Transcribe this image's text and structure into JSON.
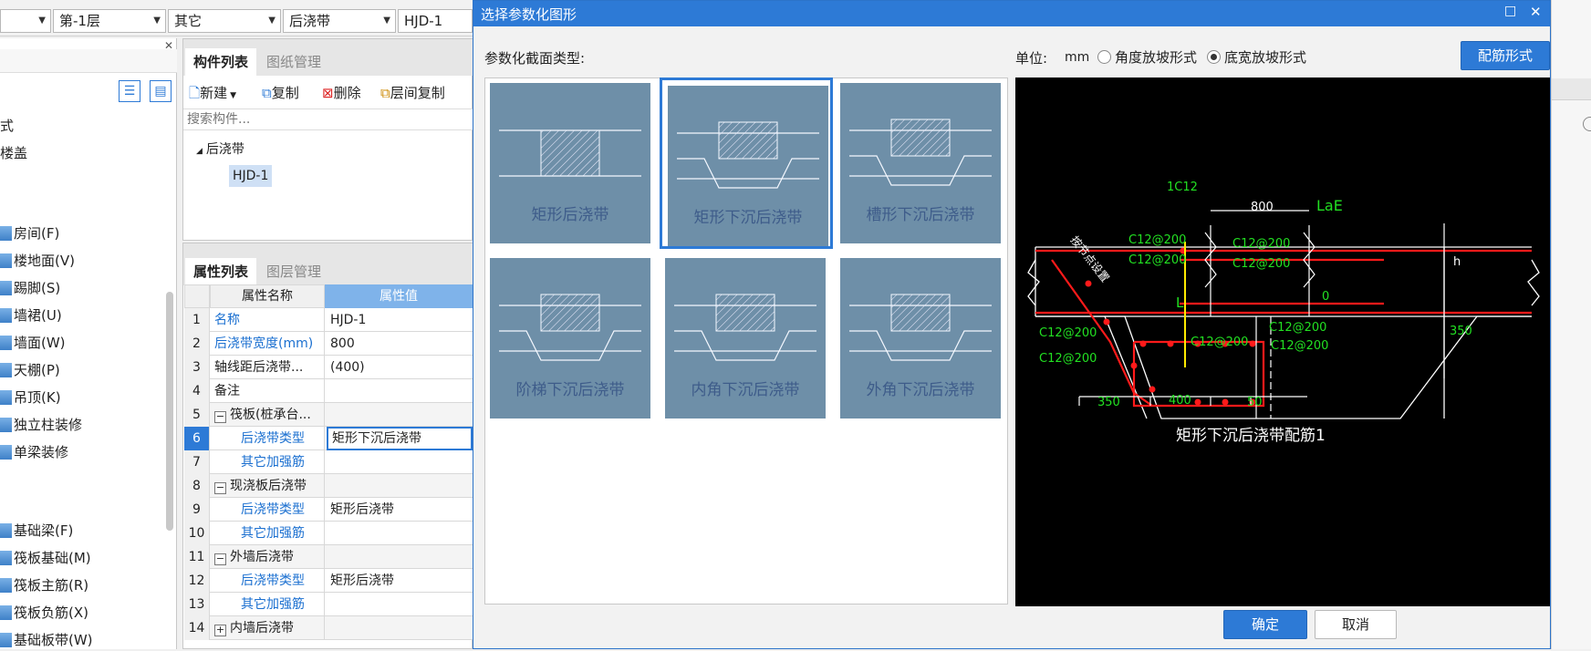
{
  "toolbar_combos": [
    {
      "value": ""
    },
    {
      "value": "第-1层"
    },
    {
      "value": "其它"
    },
    {
      "value": "后浇带"
    },
    {
      "value": "HJD-1"
    }
  ],
  "left_nav": {
    "partial_items": [
      {
        "label": "式"
      },
      {
        "label": "楼盖"
      }
    ],
    "items_a": [
      {
        "label": "房间(F)",
        "icon": "room-icon"
      },
      {
        "label": "楼地面(V)",
        "icon": "floor-icon"
      },
      {
        "label": "踢脚(S)",
        "icon": "skirting-icon"
      },
      {
        "label": "墙裙(U)",
        "icon": "wainscot-icon"
      },
      {
        "label": "墙面(W)",
        "icon": "wall-surface-icon"
      },
      {
        "label": "天棚(P)",
        "icon": "ceiling-icon"
      },
      {
        "label": "吊顶(K)",
        "icon": "suspended-ceiling-icon"
      },
      {
        "label": "独立柱装修",
        "icon": "column-finish-icon"
      },
      {
        "label": "单梁装修",
        "icon": "beam-finish-icon"
      }
    ],
    "items_b": [
      {
        "label": "基础梁(F)",
        "icon": "foundation-beam-icon"
      },
      {
        "label": "筏板基础(M)",
        "icon": "raft-foundation-icon"
      },
      {
        "label": "筏板主筋(R)",
        "icon": "raft-main-rebar-icon"
      },
      {
        "label": "筏板负筋(X)",
        "icon": "raft-neg-rebar-icon"
      },
      {
        "label": "基础板带(W)",
        "icon": "foundation-strip-icon"
      }
    ]
  },
  "component_panel": {
    "tab_active": "构件列表",
    "tab_inactive": "图纸管理",
    "actions": {
      "new": "新建",
      "copy": "复制",
      "delete": "删除",
      "floor_copy": "层间复制"
    },
    "search_placeholder": "搜索构件...",
    "tree_parent": "后浇带",
    "tree_child": "HJD-1"
  },
  "property_panel": {
    "tab_active": "属性列表",
    "tab_inactive": "图层管理",
    "col_name": "属性名称",
    "col_value": "属性值",
    "rows": [
      {
        "num": "1",
        "name": "名称",
        "value": "HJD-1"
      },
      {
        "num": "2",
        "name": "后浇带宽度(mm)",
        "value": "800"
      },
      {
        "num": "3",
        "name": "轴线距后浇带...",
        "value": "(400)"
      },
      {
        "num": "4",
        "name": "备注",
        "value": ""
      },
      {
        "num": "5",
        "name": "筏板(桩承台...",
        "value": ""
      },
      {
        "num": "6",
        "name": "后浇带类型",
        "value": "矩形下沉后浇带"
      },
      {
        "num": "7",
        "name": "其它加强筋",
        "value": ""
      },
      {
        "num": "8",
        "name": "现浇板后浇带",
        "value": ""
      },
      {
        "num": "9",
        "name": "后浇带类型",
        "value": "矩形后浇带"
      },
      {
        "num": "10",
        "name": "其它加强筋",
        "value": ""
      },
      {
        "num": "11",
        "name": "外墙后浇带",
        "value": ""
      },
      {
        "num": "12",
        "name": "后浇带类型",
        "value": "矩形后浇带"
      },
      {
        "num": "13",
        "name": "其它加强筋",
        "value": ""
      },
      {
        "num": "14",
        "name": "内墙后浇带",
        "value": ""
      }
    ]
  },
  "dialog": {
    "title": "选择参数化图形",
    "section_label": "参数化截面类型:",
    "unit_label": "单位:",
    "unit_value": "mm",
    "radio_angle": "角度放坡形式",
    "radio_width": "底宽放坡形式",
    "rebar_button": "配筋形式",
    "ok_button": "确定",
    "cancel_button": "取消",
    "shapes": [
      {
        "label": "矩形后浇带",
        "selected": false
      },
      {
        "label": "矩形下沉后浇带",
        "selected": true
      },
      {
        "label": "槽形下沉后浇带",
        "selected": false
      },
      {
        "label": "阶梯下沉后浇带",
        "selected": false
      },
      {
        "label": "内角下沉后浇带",
        "selected": false
      },
      {
        "label": "外角下沉后浇带",
        "selected": false
      }
    ],
    "preview": {
      "caption": "矩形下沉后浇带配筋1",
      "labels": {
        "c12": "1C12",
        "w800": "800",
        "lae": "LaE",
        "r1": "C12@200",
        "r2": "C12@200",
        "r3": "C12@200",
        "r4": "C12@200",
        "r5": "C12@200",
        "r6": "C12@200",
        "r7": "C12@200",
        "r8": "C12@200",
        "r9": "C12@200",
        "h": "h",
        "zero": "0",
        "l": "L",
        "h350": "350",
        "d350": "350",
        "d400": "400",
        "d50": "50",
        "note": "按节点设置"
      }
    }
  },
  "colors": {
    "accent": "#2d7ad6",
    "thumb_bg": "#6e8fa8",
    "preview_bg": "#000000",
    "rebar_red": "#ff1a1a",
    "dim_green": "#22e022"
  }
}
